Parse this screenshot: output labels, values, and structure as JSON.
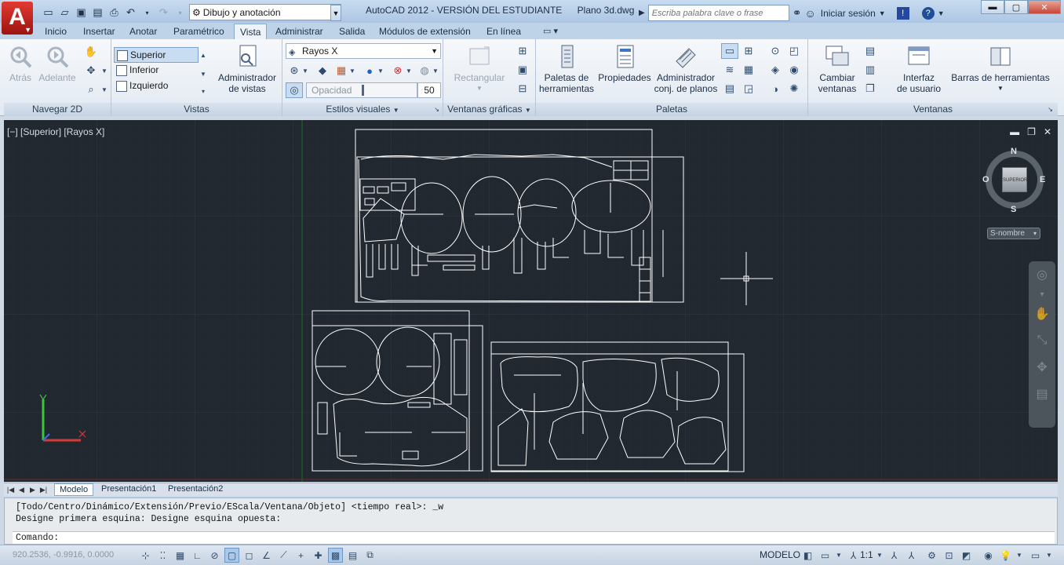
{
  "app": {
    "logo_letter": "A",
    "workspace": "Dibujo y anotación",
    "title": "AutoCAD 2012 - VERSIÓN DEL ESTUDIANTE",
    "document": "Plano 3d.dwg",
    "search_placeholder": "Escriba palabra clave o frase",
    "signin": "Iniciar sesión"
  },
  "ribbon_tabs": [
    "Inicio",
    "Insertar",
    "Anotar",
    "Paramétrico",
    "Vista",
    "Administrar",
    "Salida",
    "Módulos de extensión",
    "En línea"
  ],
  "active_tab": "Vista",
  "panels": {
    "navegar": {
      "title": "Navegar 2D",
      "back": "Atrás",
      "forward": "Adelante"
    },
    "vistas": {
      "title": "Vistas",
      "items": [
        "Superior",
        "Inferior",
        "Izquierdo"
      ],
      "selected": "Superior",
      "manager_line1": "Administrador",
      "manager_line2": "de vistas"
    },
    "estilos": {
      "title": "Estilos visuales",
      "style": "Rayos X",
      "opacity_label": "Opacidad",
      "opacity_value": "50"
    },
    "ventanas_graficas": {
      "title": "Ventanas gráficas",
      "rect": "Rectangular"
    },
    "paletas": {
      "title": "Paletas",
      "tool_palettes_1": "Paletas de",
      "tool_palettes_2": "herramientas",
      "properties": "Propiedades",
      "sheet_set_1": "Administrador",
      "sheet_set_2": "conj. de planos"
    },
    "ventanas": {
      "title": "Ventanas",
      "switch_1": "Cambiar",
      "switch_2": "ventanas",
      "ui_1": "Interfaz",
      "ui_2": "de usuario",
      "toolbars": "Barras de herramientas"
    }
  },
  "viewport": {
    "label": "[−] [Superior] [Rayos X]",
    "compass": {
      "n": "N",
      "s": "S",
      "e": "E",
      "w": "O",
      "face": "SUPERIOR"
    },
    "wcs": "S-nombre",
    "ctrl_min": "▬",
    "ctrl_restore": "❐",
    "ctrl_close": "✕"
  },
  "layout_tabs": [
    "Modelo",
    "Presentación1",
    "Presentación2"
  ],
  "active_layout": "Modelo",
  "command": {
    "history_1": "[Todo/Centro/Dinámico/Extensión/Previo/EScala/Ventana/Objeto] <tiempo real>: _w",
    "history_2": "Designe primera esquina: Designe esquina opuesta:",
    "prompt": "Comando:"
  },
  "status": {
    "coords": "920.2536, -0.9916, 0.0000",
    "space": "MODELO",
    "scale": "1:1"
  },
  "colors": {
    "canvas": "#212830",
    "geometry": "#ffffff",
    "ribbon_bg": "#e8eef5",
    "ucs_x": "#d63b3b",
    "ucs_y": "#3cc43c"
  }
}
